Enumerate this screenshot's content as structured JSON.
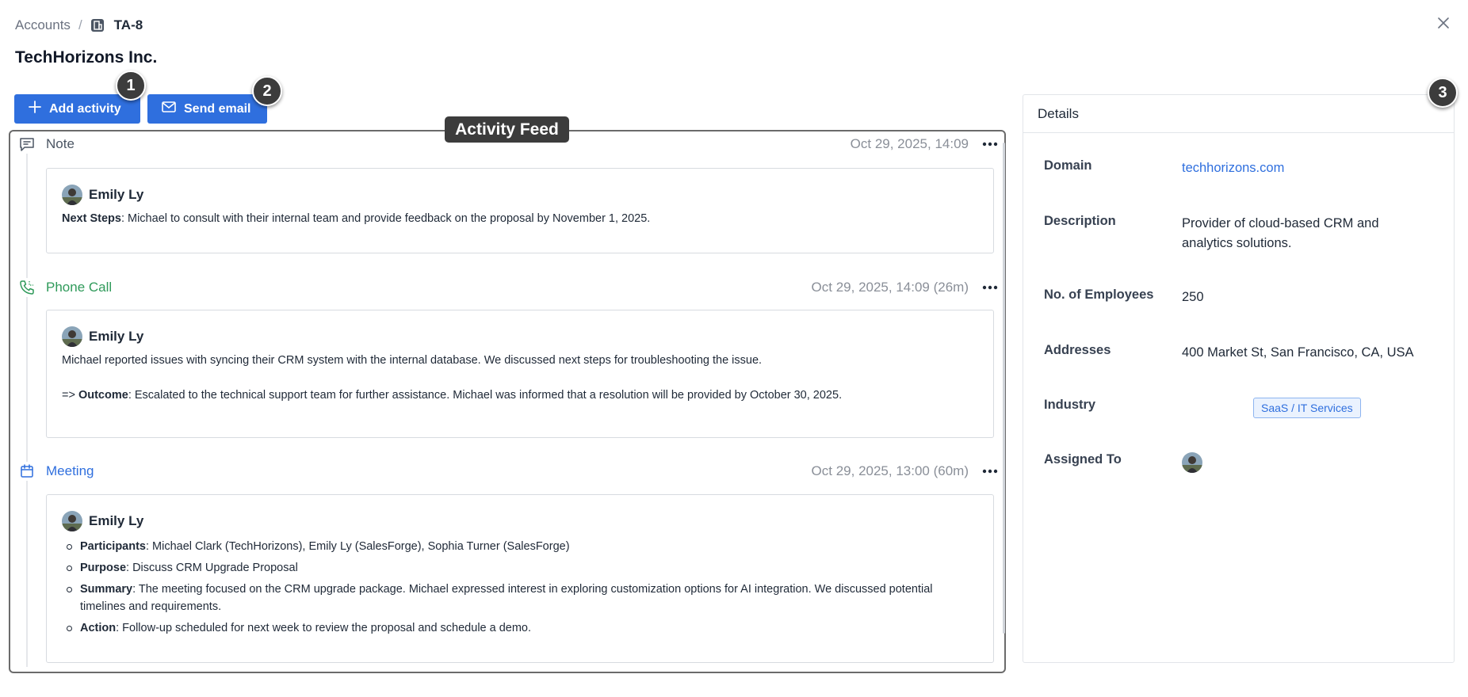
{
  "breadcrumb": {
    "parent": "Accounts",
    "separator": "/",
    "record_id": "TA-8"
  },
  "page": {
    "title": "TechHorizons Inc."
  },
  "actions": {
    "add_activity": "Add activity",
    "send_email": "Send email"
  },
  "annotations": {
    "one": "1",
    "two": "2",
    "three": "3",
    "feed_label": "Activity Feed"
  },
  "activities": [
    {
      "type": "Note",
      "time": "Oct 29, 2025, 14:09",
      "author": "Emily Ly",
      "lines": [
        {
          "label": "Next Steps",
          "text": ": Michael to consult with their internal team and provide feedback on the proposal by November 1, 2025."
        }
      ]
    },
    {
      "type": "Phone Call",
      "time": "Oct 29, 2025, 14:09 (26m)",
      "author": "Emily Ly",
      "text1": "Michael reported issues with syncing their CRM system with the internal database. We discussed next steps for troubleshooting the issue.",
      "prefix": "=> ",
      "outcome_label": "Outcome",
      "outcome_text": ": Escalated to the technical support team for further assistance. Michael was informed that a resolution will be provided by October 30, 2025."
    },
    {
      "type": "Meeting",
      "time": "Oct 29, 2025, 13:00 (60m)",
      "author": "Emily Ly",
      "items": [
        {
          "label": "Participants",
          "text": ": Michael Clark (TechHorizons), Emily Ly (SalesForge), Sophia Turner (SalesForge)"
        },
        {
          "label": "Purpose",
          "text": ": Discuss CRM Upgrade Proposal"
        },
        {
          "label": "Summary",
          "text": ": The meeting focused on the CRM upgrade package. Michael expressed interest in exploring customization options for AI integration. We discussed potential timelines and requirements."
        },
        {
          "label": "Action",
          "text": ": Follow-up scheduled for next week to review the proposal and schedule a demo."
        }
      ]
    }
  ],
  "details": {
    "title": "Details",
    "domain_label": "Domain",
    "domain_value": "techhorizons.com",
    "description_label": "Description",
    "description_value": "Provider of cloud-based CRM and analytics solutions.",
    "employees_label": "No. of Employees",
    "employees_value": "250",
    "addresses_label": "Addresses",
    "addresses_value": "400 Market St, San Francisco, CA, USA",
    "industry_label": "Industry",
    "industry_value": "SaaS / IT Services",
    "assigned_label": "Assigned To"
  },
  "colors": {
    "primary": "#2f6fde",
    "call": "#2f9a5a",
    "muted": "#8a8f98"
  },
  "icons": [
    "record-icon",
    "close-icon",
    "plus-icon",
    "mail-icon",
    "note-icon",
    "phone-call-icon",
    "calendar-icon",
    "more-icon",
    "avatar"
  ]
}
